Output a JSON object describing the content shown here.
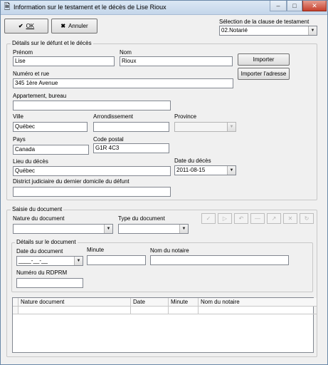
{
  "window": {
    "title": "Information sur le testament et le décès de Lise Rioux",
    "icon": "document-icon",
    "controls": [
      "–",
      "□",
      "✕"
    ]
  },
  "toolbar": {
    "ok_label": "OK",
    "cancel_label": "Annuler",
    "clause_label": "Sélection de la clause de testament",
    "clause_value": "02.Notarié"
  },
  "deceased": {
    "group_title": "Détails sur le défunt et le décès",
    "first_name_label": "Prénom",
    "first_name": "Lise",
    "last_name_label": "Nom",
    "last_name": "Rioux",
    "import_label": "Importer",
    "import_address_label": "Importer l'adresse",
    "street_label": "Numéro et rue",
    "street": "345 1ère Avenue",
    "apartment_label": "Appartement, bureau",
    "apartment": "",
    "city_label": "Ville",
    "city": "Québec",
    "borough_label": "Arrondissement",
    "borough": "",
    "province_label": "Province",
    "province": "",
    "country_label": "Pays",
    "country": "Canada",
    "postal_label": "Code postal",
    "postal": "G1R 4C3",
    "death_place_label": "Lieu du décès",
    "death_place": "Québec",
    "death_date_label": "Date du décès",
    "death_date": "2011-08-15",
    "district_label": "District judiciaire du dernier domicile du défunt",
    "district": ""
  },
  "documents": {
    "group_title": "Saisie du document",
    "nature_label": "Nature du document",
    "nature": "",
    "type_label": "Type du document",
    "type": "",
    "details_title": "Détails sur le document",
    "date_label": "Date du document",
    "date_value": "____-__-__",
    "minute_label": "Minute",
    "minute": "",
    "notary_label": "Nom du notaire",
    "notary": "",
    "rdprm_label": "Numéro du RDPRM",
    "rdprm": "",
    "tool_icons": [
      "✓",
      "▷",
      "↶",
      "—",
      "↗",
      "✕",
      "↻"
    ],
    "grid_columns": [
      "Nature document",
      "Date",
      "Minute",
      "Nom du notaire"
    ]
  }
}
